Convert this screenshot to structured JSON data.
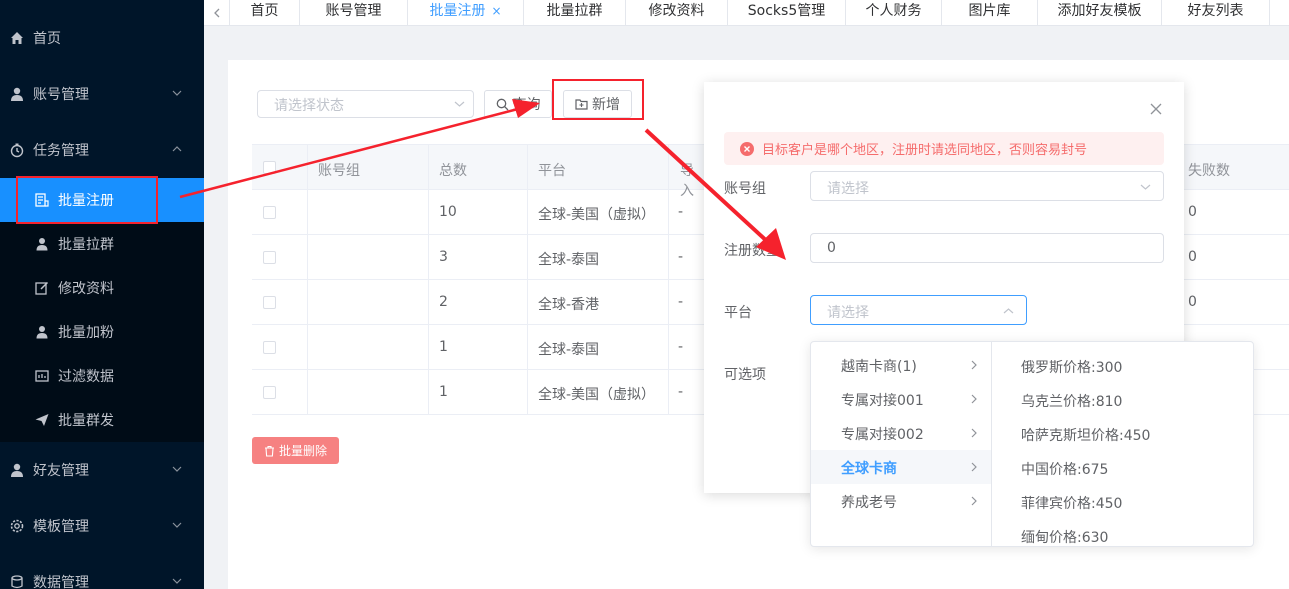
{
  "sidebar": {
    "items": [
      {
        "label": "首页",
        "icon": "home-icon"
      },
      {
        "label": "账号管理",
        "icon": "user-icon"
      },
      {
        "label": "任务管理",
        "icon": "timer-icon"
      },
      {
        "label": "好友管理",
        "icon": "user-icon"
      },
      {
        "label": "模板管理",
        "icon": "gear-icon"
      },
      {
        "label": "数据管理",
        "icon": "database-icon"
      }
    ],
    "subitems": [
      {
        "label": "批量注册",
        "icon": "register-icon",
        "active": true
      },
      {
        "label": "批量拉群",
        "icon": "user-icon"
      },
      {
        "label": "修改资料",
        "icon": "edit-icon"
      },
      {
        "label": "批量加粉",
        "icon": "user-icon"
      },
      {
        "label": "过滤数据",
        "icon": "filter-icon"
      },
      {
        "label": "批量群发",
        "icon": "send-icon"
      }
    ]
  },
  "tabs": [
    {
      "label": "首页"
    },
    {
      "label": "账号管理"
    },
    {
      "label": "批量注册",
      "active": true,
      "close": "×"
    },
    {
      "label": "批量拉群"
    },
    {
      "label": "修改资料"
    },
    {
      "label": "Socks5管理"
    },
    {
      "label": "个人财务"
    },
    {
      "label": "图片库"
    },
    {
      "label": "添加好友模板"
    },
    {
      "label": "好友列表"
    }
  ],
  "toolbar": {
    "status_placeholder": "请选择状态",
    "query_label": "查询",
    "add_label": "新增"
  },
  "table": {
    "headers": [
      "账号组",
      "总数",
      "平台",
      "导入"
    ],
    "right_header": "失败数",
    "rows": [
      {
        "group": "",
        "total": "10",
        "platform": "全球-美国（虚拟）",
        "imp": "-",
        "fail": "0"
      },
      {
        "group": "",
        "total": "3",
        "platform": "全球-泰国",
        "imp": "-",
        "fail": "0"
      },
      {
        "group": "",
        "total": "2",
        "platform": "全球-香港",
        "imp": "-",
        "fail": "0"
      },
      {
        "group": "",
        "total": "1",
        "platform": "全球-泰国",
        "imp": "-",
        "fail": ""
      },
      {
        "group": "",
        "total": "1",
        "platform": "全球-美国（虚拟）",
        "imp": "-",
        "fail": ""
      }
    ],
    "batch_delete_label": "批量删除"
  },
  "dialog": {
    "alert": "目标客户是哪个地区，注册时请选同地区，否则容易封号",
    "fields": {
      "group_label": "账号组",
      "group_placeholder": "请选择",
      "count_label": "注册数量",
      "count_value": "0",
      "platform_label": "平台",
      "platform_placeholder": "请选择",
      "options_label": "可选项"
    }
  },
  "cascader": {
    "level1": [
      {
        "label": "越南卡商(1)"
      },
      {
        "label": "专属对接001"
      },
      {
        "label": "专属对接002"
      },
      {
        "label": "全球卡商",
        "active": true
      },
      {
        "label": "养成老号"
      }
    ],
    "level2": [
      {
        "label": "俄罗斯价格:300"
      },
      {
        "label": "乌克兰价格:810"
      },
      {
        "label": "哈萨克斯坦价格:450"
      },
      {
        "label": "中国价格:675"
      },
      {
        "label": "菲律宾价格:450"
      },
      {
        "label": "缅甸价格:630"
      }
    ]
  },
  "colors": {
    "sidebar_bg": "#001529",
    "active_blue": "#1890ff",
    "accent": "#409eff",
    "danger": "#f56c6c",
    "annotation": "#f5222d"
  }
}
